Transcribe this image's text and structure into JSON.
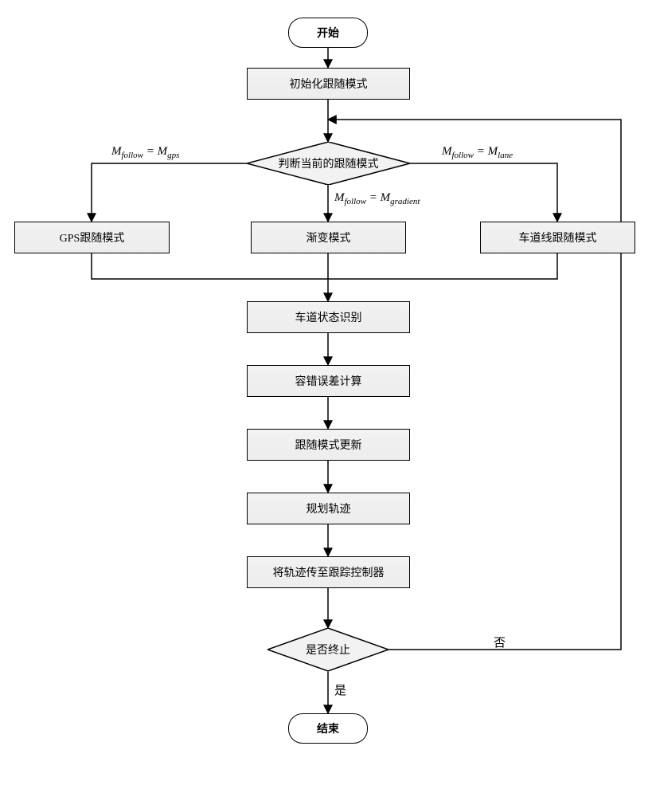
{
  "nodes": {
    "start": "开始",
    "init": "初始化跟随模式",
    "judge": "判断当前的跟随模式",
    "gps": "GPS跟随模式",
    "gradient": "渐变模式",
    "lane": "车道线跟随模式",
    "laneState": "车道状态识别",
    "tolerance": "容错误差计算",
    "update": "跟随模式更新",
    "plan": "规划轨迹",
    "send": "将轨迹传至跟踪控制器",
    "terminate": "是否终止",
    "end": "结束"
  },
  "edges": {
    "branchGps_lhs": "M",
    "branchGps_sub": "follow",
    "branchGps_rhs": "M",
    "branchGps_rsub": "gps",
    "branchGradient_lhs": "M",
    "branchGradient_sub": "follow",
    "branchGradient_rhs": "M",
    "branchGradient_rsub": "gradient",
    "branchLane_lhs": "M",
    "branchLane_sub": "follow",
    "branchLane_rhs": "M",
    "branchLane_rsub": "lane",
    "yes": "是",
    "no": "否"
  },
  "chart_data": {
    "type": "flowchart",
    "nodes": [
      {
        "id": "start",
        "shape": "terminator",
        "text": "开始"
      },
      {
        "id": "init",
        "shape": "process",
        "text": "初始化跟随模式"
      },
      {
        "id": "judge",
        "shape": "decision",
        "text": "判断当前的跟随模式"
      },
      {
        "id": "gps",
        "shape": "process",
        "text": "GPS跟随模式"
      },
      {
        "id": "gradient",
        "shape": "process",
        "text": "渐变模式"
      },
      {
        "id": "lane",
        "shape": "process",
        "text": "车道线跟随模式"
      },
      {
        "id": "laneState",
        "shape": "process",
        "text": "车道状态识别"
      },
      {
        "id": "tolerance",
        "shape": "process",
        "text": "容错误差计算"
      },
      {
        "id": "update",
        "shape": "process",
        "text": "跟随模式更新"
      },
      {
        "id": "plan",
        "shape": "process",
        "text": "规划轨迹"
      },
      {
        "id": "send",
        "shape": "process",
        "text": "将轨迹传至跟踪控制器"
      },
      {
        "id": "terminate",
        "shape": "decision",
        "text": "是否终止"
      },
      {
        "id": "end",
        "shape": "terminator",
        "text": "结束"
      }
    ],
    "edges": [
      {
        "from": "start",
        "to": "init"
      },
      {
        "from": "init",
        "to": "judge"
      },
      {
        "from": "judge",
        "to": "gps",
        "label": "M_follow = M_gps"
      },
      {
        "from": "judge",
        "to": "gradient",
        "label": "M_follow = M_gradient"
      },
      {
        "from": "judge",
        "to": "lane",
        "label": "M_follow = M_lane"
      },
      {
        "from": "gps",
        "to": "laneState"
      },
      {
        "from": "gradient",
        "to": "laneState"
      },
      {
        "from": "lane",
        "to": "laneState"
      },
      {
        "from": "laneState",
        "to": "tolerance"
      },
      {
        "from": "tolerance",
        "to": "update"
      },
      {
        "from": "update",
        "to": "plan"
      },
      {
        "from": "plan",
        "to": "send"
      },
      {
        "from": "send",
        "to": "terminate"
      },
      {
        "from": "terminate",
        "to": "end",
        "label": "是"
      },
      {
        "from": "terminate",
        "to": "judge",
        "label": "否"
      }
    ]
  }
}
